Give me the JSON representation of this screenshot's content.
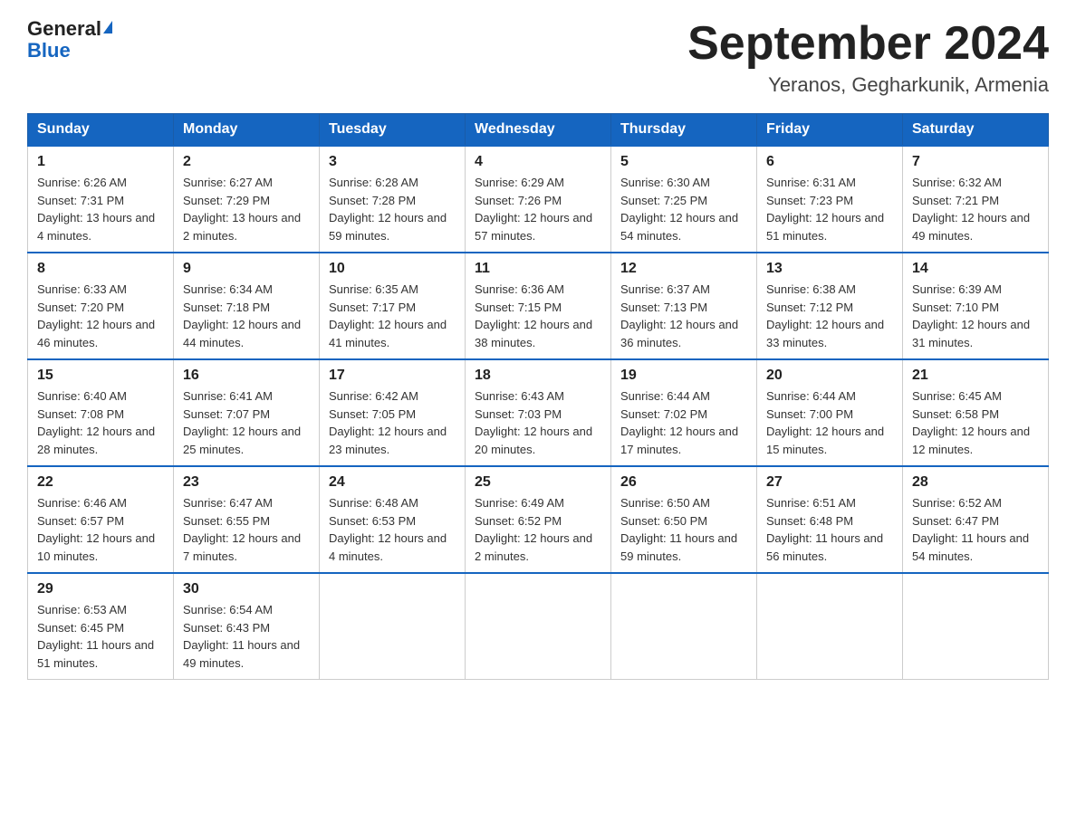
{
  "header": {
    "logo_general": "General",
    "logo_blue": "Blue",
    "month_title": "September 2024",
    "location": "Yeranos, Gegharkunik, Armenia"
  },
  "days_of_week": [
    "Sunday",
    "Monday",
    "Tuesday",
    "Wednesday",
    "Thursday",
    "Friday",
    "Saturday"
  ],
  "weeks": [
    [
      {
        "day": "1",
        "sunrise": "6:26 AM",
        "sunset": "7:31 PM",
        "daylight": "13 hours and 4 minutes."
      },
      {
        "day": "2",
        "sunrise": "6:27 AM",
        "sunset": "7:29 PM",
        "daylight": "13 hours and 2 minutes."
      },
      {
        "day": "3",
        "sunrise": "6:28 AM",
        "sunset": "7:28 PM",
        "daylight": "12 hours and 59 minutes."
      },
      {
        "day": "4",
        "sunrise": "6:29 AM",
        "sunset": "7:26 PM",
        "daylight": "12 hours and 57 minutes."
      },
      {
        "day": "5",
        "sunrise": "6:30 AM",
        "sunset": "7:25 PM",
        "daylight": "12 hours and 54 minutes."
      },
      {
        "day": "6",
        "sunrise": "6:31 AM",
        "sunset": "7:23 PM",
        "daylight": "12 hours and 51 minutes."
      },
      {
        "day": "7",
        "sunrise": "6:32 AM",
        "sunset": "7:21 PM",
        "daylight": "12 hours and 49 minutes."
      }
    ],
    [
      {
        "day": "8",
        "sunrise": "6:33 AM",
        "sunset": "7:20 PM",
        "daylight": "12 hours and 46 minutes."
      },
      {
        "day": "9",
        "sunrise": "6:34 AM",
        "sunset": "7:18 PM",
        "daylight": "12 hours and 44 minutes."
      },
      {
        "day": "10",
        "sunrise": "6:35 AM",
        "sunset": "7:17 PM",
        "daylight": "12 hours and 41 minutes."
      },
      {
        "day": "11",
        "sunrise": "6:36 AM",
        "sunset": "7:15 PM",
        "daylight": "12 hours and 38 minutes."
      },
      {
        "day": "12",
        "sunrise": "6:37 AM",
        "sunset": "7:13 PM",
        "daylight": "12 hours and 36 minutes."
      },
      {
        "day": "13",
        "sunrise": "6:38 AM",
        "sunset": "7:12 PM",
        "daylight": "12 hours and 33 minutes."
      },
      {
        "day": "14",
        "sunrise": "6:39 AM",
        "sunset": "7:10 PM",
        "daylight": "12 hours and 31 minutes."
      }
    ],
    [
      {
        "day": "15",
        "sunrise": "6:40 AM",
        "sunset": "7:08 PM",
        "daylight": "12 hours and 28 minutes."
      },
      {
        "day": "16",
        "sunrise": "6:41 AM",
        "sunset": "7:07 PM",
        "daylight": "12 hours and 25 minutes."
      },
      {
        "day": "17",
        "sunrise": "6:42 AM",
        "sunset": "7:05 PM",
        "daylight": "12 hours and 23 minutes."
      },
      {
        "day": "18",
        "sunrise": "6:43 AM",
        "sunset": "7:03 PM",
        "daylight": "12 hours and 20 minutes."
      },
      {
        "day": "19",
        "sunrise": "6:44 AM",
        "sunset": "7:02 PM",
        "daylight": "12 hours and 17 minutes."
      },
      {
        "day": "20",
        "sunrise": "6:44 AM",
        "sunset": "7:00 PM",
        "daylight": "12 hours and 15 minutes."
      },
      {
        "day": "21",
        "sunrise": "6:45 AM",
        "sunset": "6:58 PM",
        "daylight": "12 hours and 12 minutes."
      }
    ],
    [
      {
        "day": "22",
        "sunrise": "6:46 AM",
        "sunset": "6:57 PM",
        "daylight": "12 hours and 10 minutes."
      },
      {
        "day": "23",
        "sunrise": "6:47 AM",
        "sunset": "6:55 PM",
        "daylight": "12 hours and 7 minutes."
      },
      {
        "day": "24",
        "sunrise": "6:48 AM",
        "sunset": "6:53 PM",
        "daylight": "12 hours and 4 minutes."
      },
      {
        "day": "25",
        "sunrise": "6:49 AM",
        "sunset": "6:52 PM",
        "daylight": "12 hours and 2 minutes."
      },
      {
        "day": "26",
        "sunrise": "6:50 AM",
        "sunset": "6:50 PM",
        "daylight": "11 hours and 59 minutes."
      },
      {
        "day": "27",
        "sunrise": "6:51 AM",
        "sunset": "6:48 PM",
        "daylight": "11 hours and 56 minutes."
      },
      {
        "day": "28",
        "sunrise": "6:52 AM",
        "sunset": "6:47 PM",
        "daylight": "11 hours and 54 minutes."
      }
    ],
    [
      {
        "day": "29",
        "sunrise": "6:53 AM",
        "sunset": "6:45 PM",
        "daylight": "11 hours and 51 minutes."
      },
      {
        "day": "30",
        "sunrise": "6:54 AM",
        "sunset": "6:43 PM",
        "daylight": "11 hours and 49 minutes."
      },
      null,
      null,
      null,
      null,
      null
    ]
  ]
}
